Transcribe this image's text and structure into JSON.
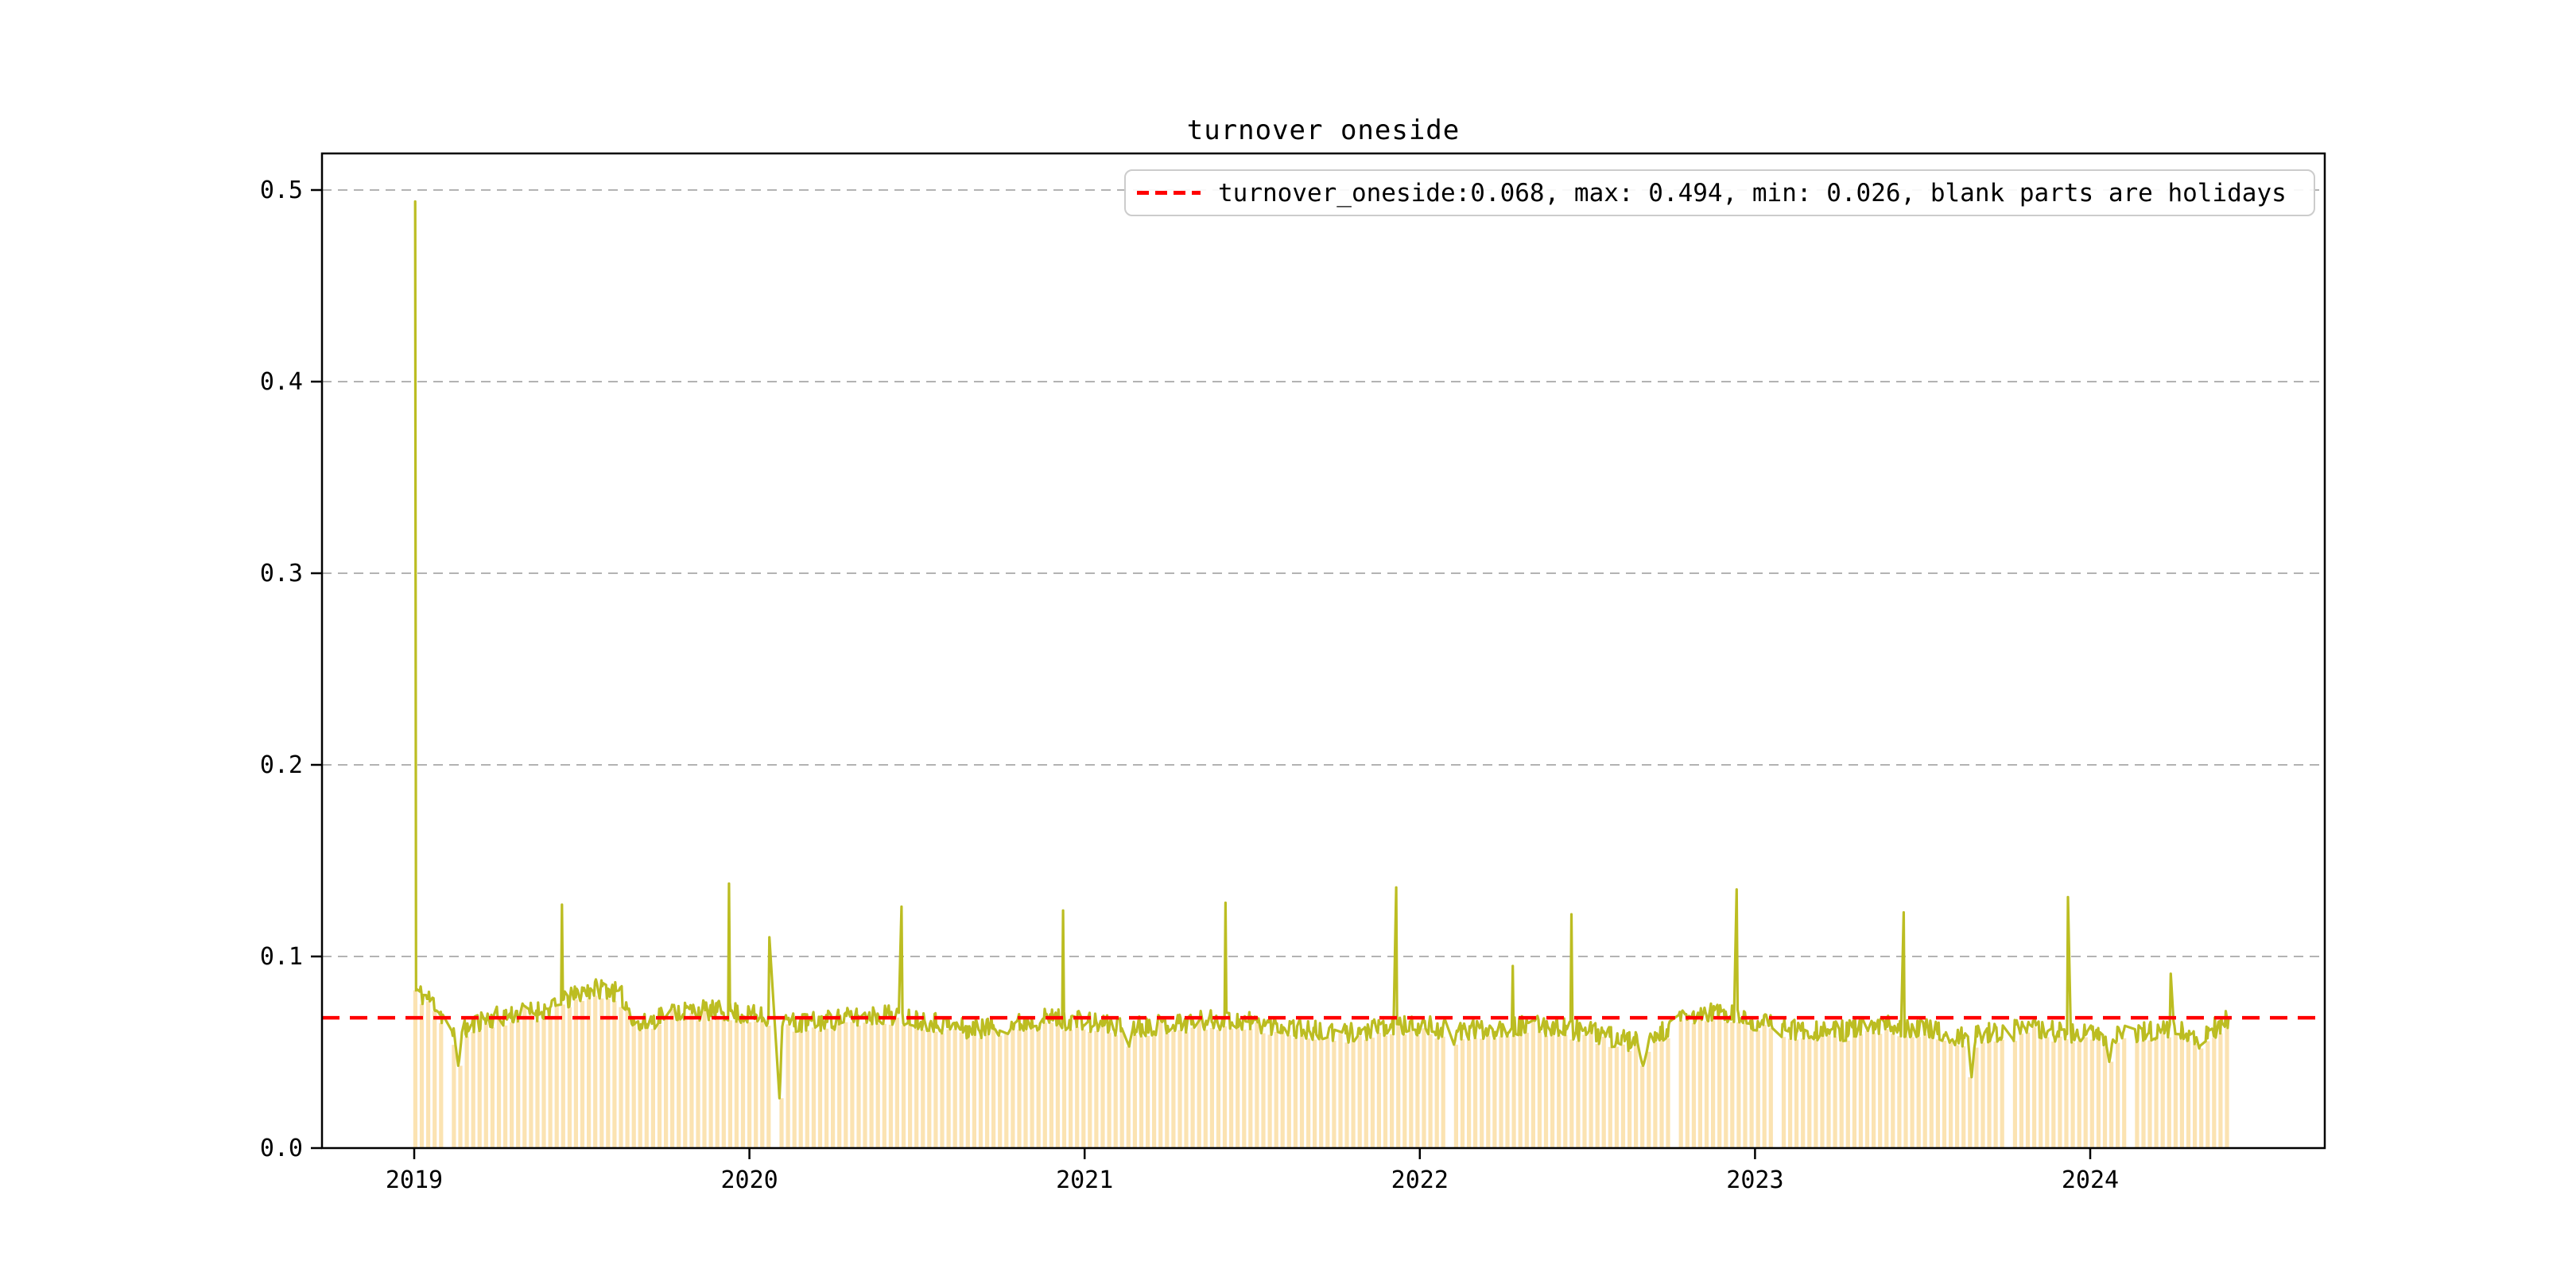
{
  "figure": {
    "title": "turnover oneside",
    "background": "#ffffff"
  },
  "legend": {
    "label": "turnover_oneside:0.068, max: 0.494, min: 0.026, blank parts are holidays",
    "marker": "red-dashed-line"
  },
  "chart_data": {
    "type": "line",
    "series_name": "turnover_oneside",
    "title": "turnover oneside",
    "current_value": 0.068,
    "max_value": 0.494,
    "min_value": 0.026,
    "reference_line": 0.068,
    "x_tick_labels": [
      "2019",
      "2020",
      "2021",
      "2022",
      "2023",
      "2024"
    ],
    "y_ticks": [
      0.0,
      0.1,
      0.2,
      0.3,
      0.4,
      0.5
    ],
    "y_tick_labels": [
      "0.0",
      "0.1",
      "0.2",
      "0.3",
      "0.4",
      "0.5"
    ],
    "ylim": [
      0,
      0.519
    ],
    "grid": "horizontal-dashed",
    "legend_position": "upper-right",
    "x_start_date": "2019-01-02",
    "x_end_date": "2024-05-31",
    "note_from_legend": "blank parts are holidays",
    "baseline_anchors": [
      [
        2019.005,
        0.082
      ],
      [
        2019.06,
        0.076
      ],
      [
        2019.12,
        0.058
      ],
      [
        2019.2,
        0.067
      ],
      [
        2019.3,
        0.07
      ],
      [
        2019.42,
        0.073
      ],
      [
        2019.5,
        0.082
      ],
      [
        2019.57,
        0.084
      ],
      [
        2019.62,
        0.079
      ],
      [
        2019.67,
        0.063
      ],
      [
        2019.75,
        0.071
      ],
      [
        2019.85,
        0.072
      ],
      [
        2019.95,
        0.071
      ],
      [
        2020.05,
        0.068
      ],
      [
        2020.15,
        0.065
      ],
      [
        2020.3,
        0.068
      ],
      [
        2020.42,
        0.07
      ],
      [
        2020.55,
        0.066
      ],
      [
        2020.65,
        0.062
      ],
      [
        2020.8,
        0.065
      ],
      [
        2020.9,
        0.068
      ],
      [
        2021.0,
        0.066
      ],
      [
        2021.12,
        0.063
      ],
      [
        2021.25,
        0.065
      ],
      [
        2021.4,
        0.067
      ],
      [
        2021.5,
        0.066
      ],
      [
        2021.62,
        0.063
      ],
      [
        2021.75,
        0.059
      ],
      [
        2021.88,
        0.062
      ],
      [
        2022.0,
        0.064
      ],
      [
        2022.12,
        0.061
      ],
      [
        2022.25,
        0.063
      ],
      [
        2022.4,
        0.064
      ],
      [
        2022.55,
        0.059
      ],
      [
        2022.67,
        0.054
      ],
      [
        2022.78,
        0.067
      ],
      [
        2022.88,
        0.071
      ],
      [
        2023.0,
        0.066
      ],
      [
        2023.12,
        0.062
      ],
      [
        2023.25,
        0.061
      ],
      [
        2023.4,
        0.064
      ],
      [
        2023.5,
        0.063
      ],
      [
        2023.6,
        0.057
      ],
      [
        2023.72,
        0.061
      ],
      [
        2023.85,
        0.062
      ],
      [
        2023.95,
        0.06
      ],
      [
        2024.05,
        0.058
      ],
      [
        2024.15,
        0.061
      ],
      [
        2024.25,
        0.062
      ],
      [
        2024.33,
        0.057
      ],
      [
        2024.41,
        0.068
      ]
    ],
    "spikes": [
      [
        "2019-01-02",
        0.494
      ],
      [
        "2019-06-11",
        0.127
      ],
      [
        "2019-12-10",
        0.138
      ],
      [
        "2020-01-23",
        0.11
      ],
      [
        "2020-06-15",
        0.126
      ],
      [
        "2020-12-08",
        0.124
      ],
      [
        "2021-06-03",
        0.128
      ],
      [
        "2021-12-06",
        0.136
      ],
      [
        "2022-04-12",
        0.095
      ],
      [
        "2022-06-15",
        0.122
      ],
      [
        "2022-12-12",
        0.135
      ],
      [
        "2023-06-12",
        0.123
      ],
      [
        "2023-12-08",
        0.131
      ],
      [
        "2024-03-29",
        0.091
      ]
    ],
    "dips": [
      [
        "2019-02-18",
        0.043,
        4
      ],
      [
        "2020-02-03",
        0.026,
        3
      ],
      [
        "2021-02-18",
        0.053,
        3
      ],
      [
        "2022-02-07",
        0.054,
        3
      ],
      [
        "2022-09-01",
        0.043,
        6
      ],
      [
        "2023-08-25",
        0.037,
        4
      ],
      [
        "2024-01-22",
        0.045,
        4
      ],
      [
        "2024-04-29",
        0.052,
        3
      ]
    ],
    "holidays": [
      [
        "2019-02-04",
        "2019-02-10"
      ],
      [
        "2019-04-05",
        "2019-04-07"
      ],
      [
        "2019-05-01",
        "2019-05-05"
      ],
      [
        "2019-06-07",
        "2019-06-09"
      ],
      [
        "2019-09-13",
        "2019-09-15"
      ],
      [
        "2019-10-01",
        "2019-10-07"
      ],
      [
        "2020-01-01",
        "2020-01-01"
      ],
      [
        "2020-01-24",
        "2020-02-02"
      ],
      [
        "2020-04-04",
        "2020-04-06"
      ],
      [
        "2020-05-01",
        "2020-05-05"
      ],
      [
        "2020-06-25",
        "2020-06-28"
      ],
      [
        "2020-10-01",
        "2020-10-08"
      ],
      [
        "2021-01-01",
        "2021-01-03"
      ],
      [
        "2021-02-11",
        "2021-02-17"
      ],
      [
        "2021-04-03",
        "2021-04-05"
      ],
      [
        "2021-05-01",
        "2021-05-05"
      ],
      [
        "2021-06-12",
        "2021-06-14"
      ],
      [
        "2021-09-19",
        "2021-09-21"
      ],
      [
        "2021-10-01",
        "2021-10-07"
      ],
      [
        "2022-01-01",
        "2022-01-03"
      ],
      [
        "2022-01-31",
        "2022-02-06"
      ],
      [
        "2022-04-03",
        "2022-04-05"
      ],
      [
        "2022-04-30",
        "2022-05-04"
      ],
      [
        "2022-06-03",
        "2022-06-05"
      ],
      [
        "2022-09-10",
        "2022-09-12"
      ],
      [
        "2022-10-01",
        "2022-10-07"
      ],
      [
        "2023-01-01",
        "2023-01-02"
      ],
      [
        "2023-01-21",
        "2023-01-27"
      ],
      [
        "2023-04-05",
        "2023-04-05"
      ],
      [
        "2023-04-29",
        "2023-05-03"
      ],
      [
        "2023-06-22",
        "2023-06-25"
      ],
      [
        "2023-09-29",
        "2023-10-06"
      ],
      [
        "2024-01-01",
        "2024-01-01"
      ],
      [
        "2024-02-10",
        "2024-02-17"
      ],
      [
        "2024-04-04",
        "2024-04-06"
      ],
      [
        "2024-05-01",
        "2024-05-05"
      ]
    ],
    "noise": {
      "amplitude": 0.0055,
      "seed": 11
    },
    "bars": "weekly-min-of-daily-values",
    "colors": {
      "line": "#bcbd22",
      "bars": "#fbe3b2",
      "reference": "#ff0000",
      "grid": "#b3b3b3",
      "frame": "#000000",
      "text": "#000000",
      "legend_border": "#cccccc"
    }
  }
}
